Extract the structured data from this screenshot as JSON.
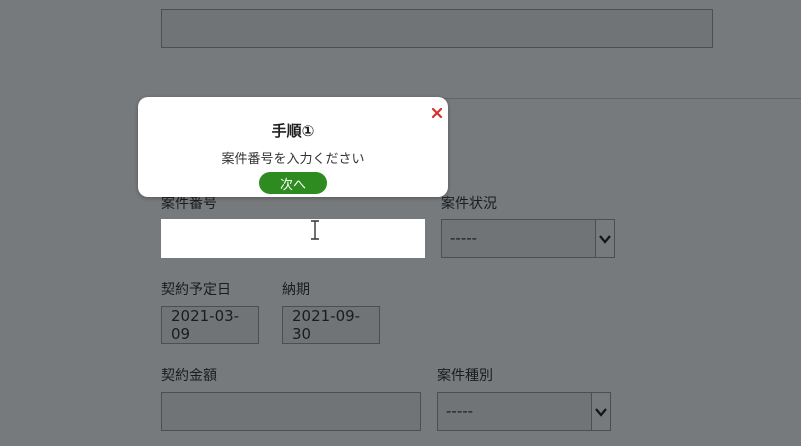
{
  "form": {
    "top_field_value": "",
    "project_number": {
      "label": "案件番号",
      "value": ""
    },
    "project_status": {
      "label": "案件状況",
      "selected": "-----"
    },
    "planned_contract_date": {
      "label": "契約予定日",
      "value": "2021-03-09"
    },
    "delivery_date": {
      "label": "納期",
      "value": "2021-09-30"
    },
    "contract_amount": {
      "label": "契約金額",
      "value": ""
    },
    "project_type": {
      "label": "案件種別",
      "selected": "-----"
    }
  },
  "popup": {
    "title": "手順①",
    "message": "案件番号を入力ください",
    "next_label": "次へ",
    "close_glyph": "×"
  },
  "colors": {
    "overlay": "#3a4348",
    "next_button": "#2e8b1f",
    "close_icon": "#d32f2f"
  },
  "icons": {
    "close": "close-icon",
    "dropdown": "chevron-down-icon",
    "cursor": "text-cursor-icon"
  }
}
